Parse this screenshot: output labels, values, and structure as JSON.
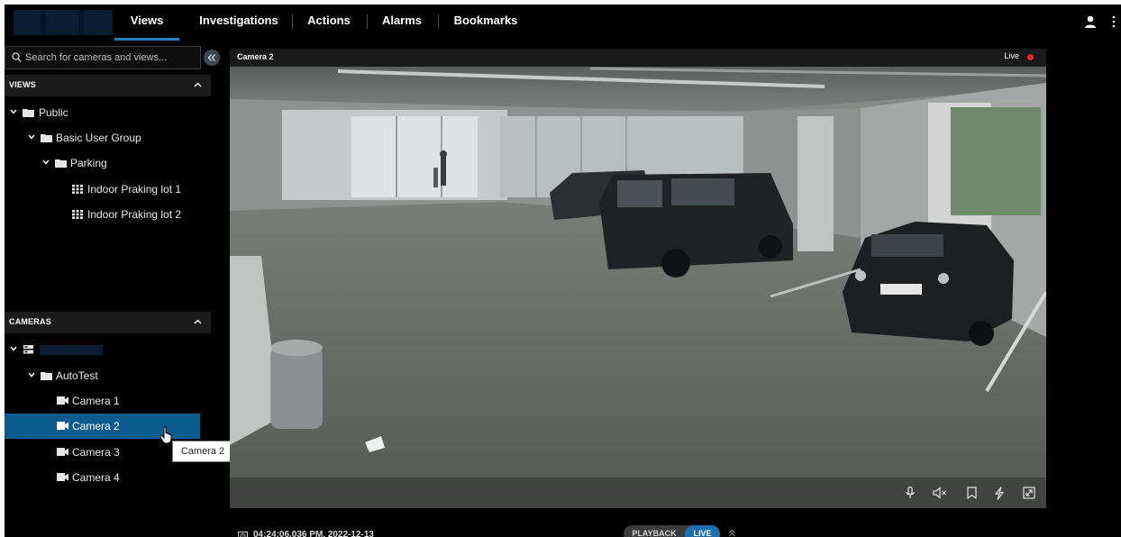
{
  "nav": {
    "tabs": [
      {
        "label": "Views",
        "active": true
      },
      {
        "label": "Investigations",
        "active": false
      },
      {
        "label": "Actions",
        "active": false
      },
      {
        "label": "Alarms",
        "active": false
      },
      {
        "label": "Bookmarks",
        "active": false
      }
    ],
    "icons": [
      "user-icon",
      "more-vertical-icon"
    ]
  },
  "sidebar": {
    "search": {
      "placeholder": "Search for cameras and views..."
    },
    "views_section": {
      "title": "VIEWS",
      "tree": [
        {
          "label": "Public",
          "type": "folder",
          "expanded": true
        },
        {
          "label": "Basic User Group",
          "type": "folder",
          "expanded": true
        },
        {
          "label": "Parking",
          "type": "folder",
          "expanded": true
        },
        {
          "label": "Indoor Praking lot 1",
          "type": "view"
        },
        {
          "label": "Indoor Praking lot 2",
          "type": "view"
        }
      ]
    },
    "cameras_section": {
      "title": "CAMERAS",
      "tree": [
        {
          "label": "",
          "type": "server",
          "expanded": true
        },
        {
          "label": "AutoTest",
          "type": "folder",
          "expanded": true
        },
        {
          "label": "Camera 1",
          "type": "camera",
          "selected": false
        },
        {
          "label": "Camera 2",
          "type": "camera",
          "selected": true
        },
        {
          "label": "Camera 3",
          "type": "camera",
          "selected": false
        },
        {
          "label": "Camera 4",
          "type": "camera",
          "selected": false
        }
      ]
    },
    "tooltip": "Camera 2"
  },
  "video": {
    "title": "Camera 2",
    "live_label": "Live",
    "controls": [
      "microphone-icon",
      "speaker-muted-icon",
      "bookmark-icon",
      "lightning-icon",
      "fullscreen-icon"
    ]
  },
  "footer": {
    "timestamp": "04:24:06.036 PM, 2022-12-13",
    "playback_label": "PLAYBACK",
    "live_label": "LIVE"
  },
  "colors": {
    "accent": "#1f7fc0",
    "selected_row": "#0b5b8e",
    "live_dot": "#e8242a",
    "background": "#000000"
  }
}
